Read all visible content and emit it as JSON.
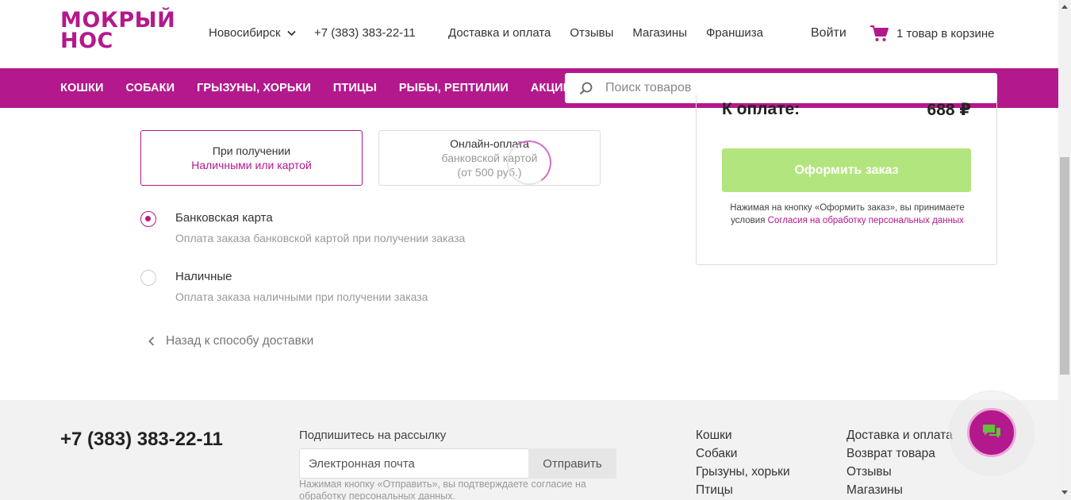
{
  "header": {
    "logo_line1": "МОКРЫЙ",
    "logo_line2": "НОС",
    "city": "Новосибирск",
    "phone": "+7 (383) 383-22-11",
    "nav": [
      "Доставка и оплата",
      "Отзывы",
      "Магазины",
      "Франшиза"
    ],
    "login": "Войти",
    "cart_label": "1 товар в корзине"
  },
  "categories": [
    "КОШКИ",
    "СОБАКИ",
    "ГРЫЗУНЫ, ХОРЬКИ",
    "ПТИЦЫ",
    "РЫБЫ, РЕПТИЛИИ",
    "АКЦИИ"
  ],
  "search": {
    "placeholder": "Поиск товаров"
  },
  "payment": {
    "option1": {
      "title": "При получении",
      "subtitle": "Наличными или картой"
    },
    "option2": {
      "title": "Онлайн-оплата",
      "subtitle": "банковской картой",
      "note": "(от 500 руб.)"
    },
    "methods": [
      {
        "label": "Банковская карта",
        "desc": "Оплата заказа банковской картой при получении заказа",
        "checked": true
      },
      {
        "label": "Наличные",
        "desc": "Оплата заказа наличными при получении заказа",
        "checked": false
      }
    ],
    "back": "Назад к способу доставки"
  },
  "summary": {
    "total_label": "К оплате:",
    "total_value": "688 ₽",
    "order_button": "Оформить заказ",
    "agree_text": "Нажимая на кнопку «Оформить заказ», вы принимаете условия",
    "agree_link": "Согласия на обработку персональных данных"
  },
  "footer": {
    "phone": "+7 (383) 383-22-11",
    "subscribe_title": "Подпишитесь на рассылку",
    "email_placeholder": "Электронная почта",
    "send_button": "Отправить",
    "subscribe_note": "Нажимая кнопку «Отправить», вы подтверждаете согласие на обработку персональных данных.",
    "col1": [
      "Кошки",
      "Собаки",
      "Грызуны, хорьки",
      "Птицы"
    ],
    "col2": [
      "Доставка и оплата",
      "Возврат товара",
      "Отзывы",
      "Магазины"
    ]
  },
  "colors": {
    "brand": "#b3198c",
    "order_button": "#b3e57e"
  }
}
